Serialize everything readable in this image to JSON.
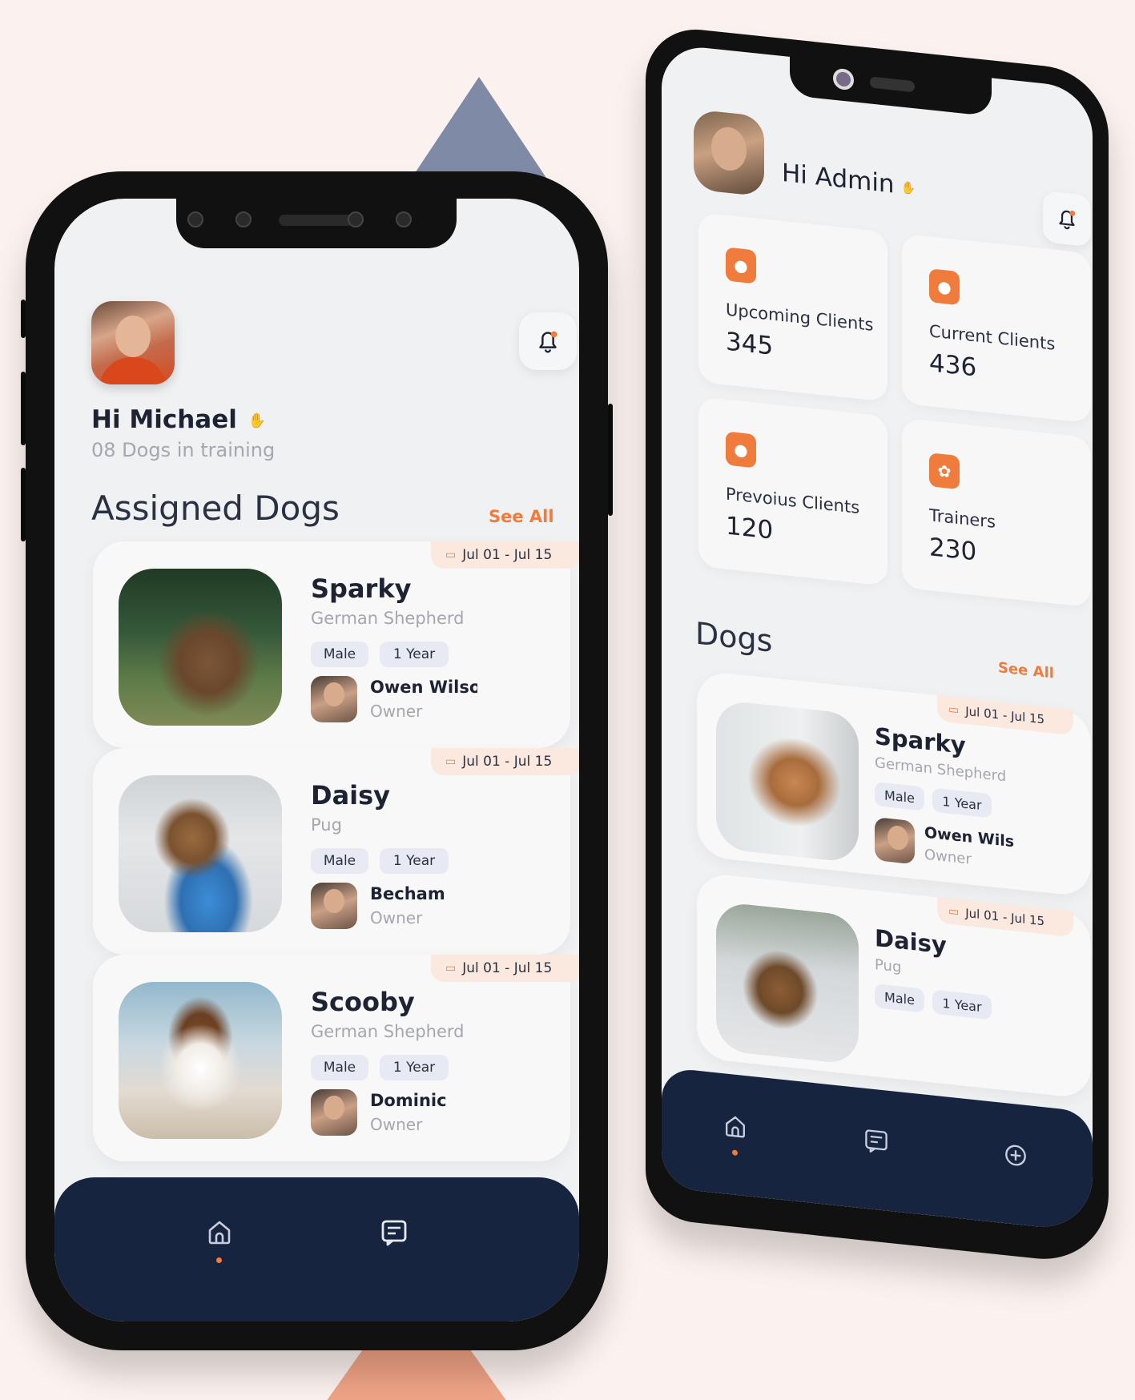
{
  "colors": {
    "accent": "#ef7b3d",
    "navy": "#16243f",
    "background": "#fbf1ee"
  },
  "trainer_screen": {
    "greeting": "Hi Michael",
    "subtitle": "08 Dogs in training",
    "section_title": "Assigned Dogs",
    "see_all": "See All",
    "dogs": [
      {
        "name": "Sparky",
        "breed": "German Shepherd",
        "gender": "Male",
        "age": "1 Year",
        "owner": "Owen Wilson",
        "owner_role": "Owner",
        "dates": "Jul 01 - Jul 15"
      },
      {
        "name": "Daisy",
        "breed": "Pug",
        "gender": "Male",
        "age": "1 Year",
        "owner": "Becham",
        "owner_role": "Owner",
        "dates": "Jul 01 - Jul 15"
      },
      {
        "name": "Scooby",
        "breed": "German Shepherd",
        "gender": "Male",
        "age": "1 Year",
        "owner": "Dominic",
        "owner_role": "Owner",
        "dates": "Jul 01 - Jul 15"
      }
    ],
    "nav": [
      {
        "icon": "home-icon",
        "active": true
      },
      {
        "icon": "chat-icon",
        "active": false
      }
    ]
  },
  "admin_screen": {
    "greeting": "Hi Admin",
    "stats": [
      {
        "label": "Upcoming Clients",
        "value": "345",
        "icon": "person-icon"
      },
      {
        "label": "Current Clients",
        "value": "436",
        "icon": "person-icon"
      },
      {
        "label": "Prevoius Clients",
        "value": "120",
        "icon": "person-icon"
      },
      {
        "label": "Trainers",
        "value": "230",
        "icon": "paw-icon"
      }
    ],
    "section_title": "Dogs",
    "see_all": "See All",
    "dogs": [
      {
        "name": "Sparky",
        "breed": "German Shepherd",
        "gender": "Male",
        "age": "1 Year",
        "owner": "Owen Wilson",
        "owner_role": "Owner",
        "dates": "Jul 01 - Jul 15"
      },
      {
        "name": "Daisy",
        "breed": "Pug",
        "gender": "Male",
        "age": "1 Year",
        "dates": "Jul 01 - Jul 15"
      }
    ],
    "nav": [
      {
        "icon": "home-icon",
        "active": true
      },
      {
        "icon": "chat-icon",
        "active": false
      },
      {
        "icon": "add-circle-icon",
        "active": false
      }
    ]
  }
}
